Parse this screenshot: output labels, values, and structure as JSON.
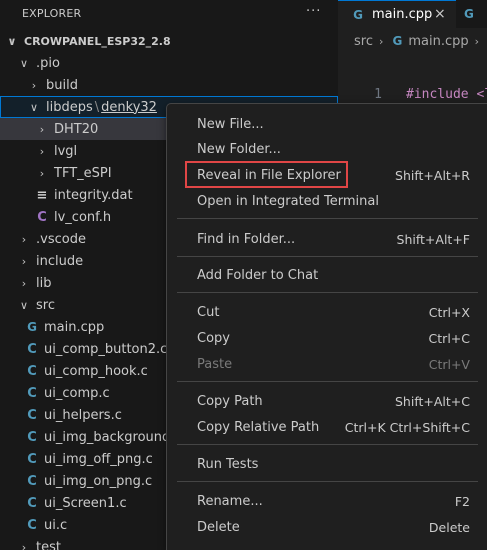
{
  "sidebar": {
    "header": "EXPLORER",
    "more_glyph": "···",
    "root": {
      "chevron": "∨",
      "label": "CROWPANEL_ESP32_2.8"
    },
    "tree": [
      {
        "name": "tree-item-pio",
        "chevron": "∨",
        "icon": "",
        "label": ".pio"
      },
      {
        "name": "tree-item-build",
        "chevron": "›",
        "icon": "",
        "label": "build"
      },
      {
        "name": "tree-item-libdeps",
        "chevron": "∨",
        "icon": "",
        "label": "libdeps",
        "sep": "\\",
        "label2": "denky32"
      },
      {
        "name": "tree-item-dht20",
        "chevron": "›",
        "icon": "",
        "label": "DHT20"
      },
      {
        "name": "tree-item-lvgl",
        "chevron": "›",
        "icon": "",
        "label": "lvgl"
      },
      {
        "name": "tree-item-tft-espi",
        "chevron": "›",
        "icon": "",
        "label": "TFT_eSPI"
      },
      {
        "name": "tree-item-integrity",
        "chevron": "",
        "icon": "≡",
        "label": "integrity.dat"
      },
      {
        "name": "tree-item-lv-conf",
        "chevron": "",
        "icon": "C",
        "label": "lv_conf.h"
      },
      {
        "name": "tree-item-vscode",
        "chevron": "›",
        "icon": "",
        "label": ".vscode"
      },
      {
        "name": "tree-item-include",
        "chevron": "›",
        "icon": "",
        "label": "include"
      },
      {
        "name": "tree-item-lib",
        "chevron": "›",
        "icon": "",
        "label": "lib"
      },
      {
        "name": "tree-item-src",
        "chevron": "∨",
        "icon": "",
        "label": "src"
      },
      {
        "name": "tree-item-main-cpp",
        "chevron": "",
        "icon": "G",
        "label": "main.cpp"
      },
      {
        "name": "tree-item-ui-comp-button2",
        "chevron": "",
        "icon": "C",
        "label": "ui_comp_button2.c"
      },
      {
        "name": "tree-item-ui-comp-hook",
        "chevron": "",
        "icon": "C",
        "label": "ui_comp_hook.c"
      },
      {
        "name": "tree-item-ui-comp",
        "chevron": "",
        "icon": "C",
        "label": "ui_comp.c"
      },
      {
        "name": "tree-item-ui-helpers",
        "chevron": "",
        "icon": "C",
        "label": "ui_helpers.c"
      },
      {
        "name": "tree-item-ui-img-background",
        "chevron": "",
        "icon": "C",
        "label": "ui_img_background_p"
      },
      {
        "name": "tree-item-ui-img-off",
        "chevron": "",
        "icon": "C",
        "label": "ui_img_off_png.c"
      },
      {
        "name": "tree-item-ui-img-on",
        "chevron": "",
        "icon": "C",
        "label": "ui_img_on_png.c"
      },
      {
        "name": "tree-item-ui-screen1",
        "chevron": "",
        "icon": "C",
        "label": "ui_Screen1.c"
      },
      {
        "name": "tree-item-ui-c",
        "chevron": "",
        "icon": "C",
        "label": "ui.c"
      },
      {
        "name": "tree-item-test",
        "chevron": "›",
        "icon": "",
        "label": "test"
      }
    ]
  },
  "editor": {
    "tab_icon": "G",
    "tab_label": "main.cpp",
    "tab_close": "×",
    "tab2_icon": "G",
    "breadcrumb": {
      "folder": "src",
      "sep": "›",
      "icon": "G",
      "file": "main.cpp",
      "sep2": "›",
      "icon2": "G"
    },
    "line_number": "1",
    "code": "#include <l"
  },
  "menu": {
    "items": [
      {
        "name": "menu-new-file",
        "label": "New File...",
        "shortcut": "",
        "disabled": false
      },
      {
        "name": "menu-new-folder",
        "label": "New Folder...",
        "shortcut": "",
        "disabled": false
      },
      {
        "name": "menu-reveal-in-file-explorer",
        "label": "Reveal in File Explorer",
        "shortcut": "Shift+Alt+R",
        "disabled": false
      },
      {
        "name": "menu-open-in-integrated-terminal",
        "label": "Open in Integrated Terminal",
        "shortcut": "",
        "disabled": false
      },
      {
        "name": "menu-find-in-folder",
        "label": "Find in Folder...",
        "shortcut": "Shift+Alt+F",
        "disabled": false
      },
      {
        "name": "menu-add-folder-to-chat",
        "label": "Add Folder to Chat",
        "shortcut": "",
        "disabled": false
      },
      {
        "name": "menu-cut",
        "label": "Cut",
        "shortcut": "Ctrl+X",
        "disabled": false
      },
      {
        "name": "menu-copy",
        "label": "Copy",
        "shortcut": "Ctrl+C",
        "disabled": false
      },
      {
        "name": "menu-paste",
        "label": "Paste",
        "shortcut": "Ctrl+V",
        "disabled": true
      },
      {
        "name": "menu-copy-path",
        "label": "Copy Path",
        "shortcut": "Shift+Alt+C",
        "disabled": false
      },
      {
        "name": "menu-copy-relative-path",
        "label": "Copy Relative Path",
        "shortcut": "Ctrl+K Ctrl+Shift+C",
        "disabled": false
      },
      {
        "name": "menu-run-tests",
        "label": "Run Tests",
        "shortcut": "",
        "disabled": false
      },
      {
        "name": "menu-rename",
        "label": "Rename...",
        "shortcut": "F2",
        "disabled": false
      },
      {
        "name": "menu-delete",
        "label": "Delete",
        "shortcut": "Delete",
        "disabled": false
      }
    ]
  },
  "colors": {
    "highlight_box": "#e04646",
    "focus_outline": "#0078d4",
    "c_icon": "#519aba",
    "h_icon": "#a074c4"
  }
}
